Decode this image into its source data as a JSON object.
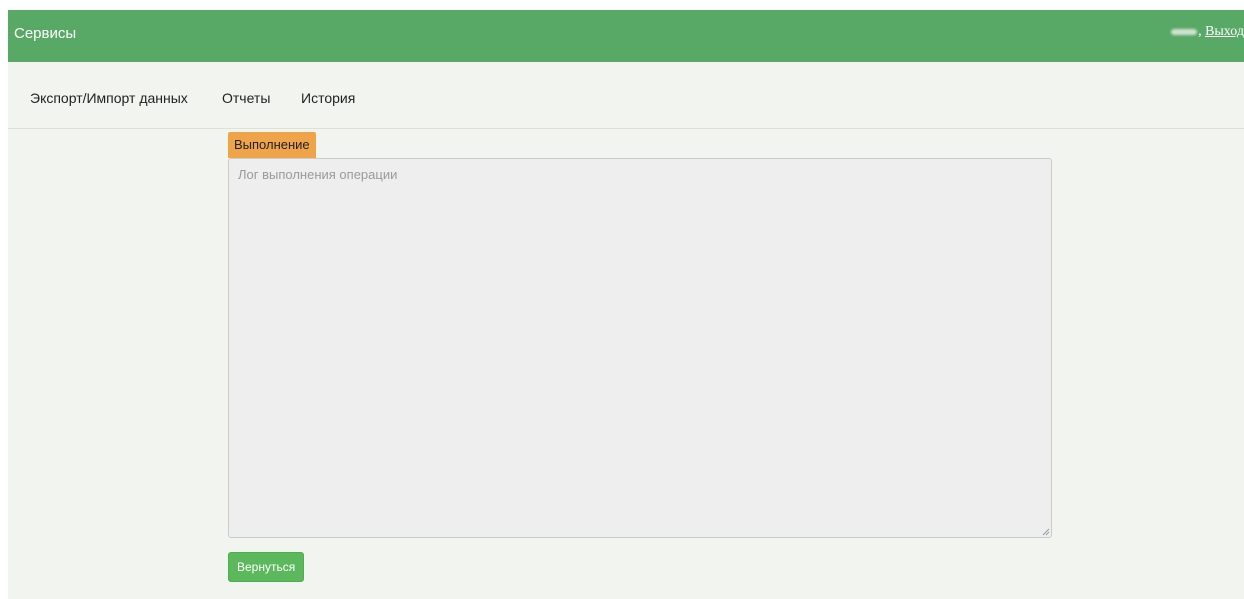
{
  "header": {
    "title": "Сервисы",
    "logout_label": "Выход",
    "separator": ","
  },
  "nav": {
    "items": [
      {
        "label": "Экспорт/Импорт данных"
      },
      {
        "label": "Отчеты"
      },
      {
        "label": "История"
      }
    ]
  },
  "main": {
    "tab_label": "Выполнение",
    "log_placeholder": "Лог выполнения операции",
    "log_value": "",
    "back_button_label": "Вернуться"
  },
  "colors": {
    "header_bg": "#58a866",
    "page_bg": "#f2f5ef",
    "tab_bg": "#f0a44a",
    "button_bg": "#5cb85c"
  },
  "icons": {
    "resize_grip": "resize-grip-icon"
  }
}
